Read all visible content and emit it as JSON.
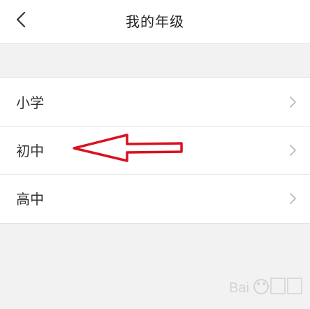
{
  "header": {
    "title": "我的年级",
    "back_icon": "chevron-left-icon"
  },
  "grades": [
    {
      "label": "小学",
      "icon": "chevron-right-icon"
    },
    {
      "label": "初中",
      "icon": "chevron-right-icon"
    },
    {
      "label": "高中",
      "icon": "chevron-right-icon"
    }
  ],
  "annotation": {
    "icon": "red-arrow-icon",
    "color": "#d9121f"
  },
  "watermark": {
    "icon": "baidu-jingyan-watermark",
    "text": "Baidu 经验"
  },
  "colors": {
    "background": "#f2f2f2",
    "surface": "#ffffff",
    "chevron": "#bbbbbb"
  }
}
